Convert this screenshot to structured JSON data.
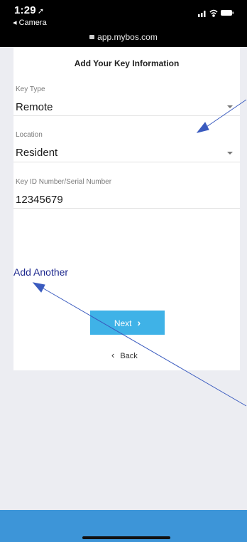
{
  "status_bar": {
    "time": "1:29",
    "back_app": "◂ Camera",
    "url": "app.mybos.com"
  },
  "form": {
    "title": "Add Your Key Information",
    "fields": [
      {
        "label": "Key Type",
        "value": "Remote"
      },
      {
        "label": "Location",
        "value": "Resident"
      },
      {
        "label": "Key ID Number/Serial Number",
        "value": "12345679"
      }
    ],
    "add_another": "Add Another",
    "next_label": "Next",
    "back_label": "Back"
  },
  "colors": {
    "next_button": "#3fb2e7",
    "add_another": "#1f2a8f",
    "annotation_arrow": "#3a5bbf",
    "bottom_bar": "#3d95d8"
  },
  "icons": [
    "location-arrow-icon",
    "signal-bars-icon",
    "wifi-icon",
    "battery-icon",
    "lock-icon",
    "chevron-right-icon",
    "chevron-left-icon",
    "caret-down-icon"
  ]
}
